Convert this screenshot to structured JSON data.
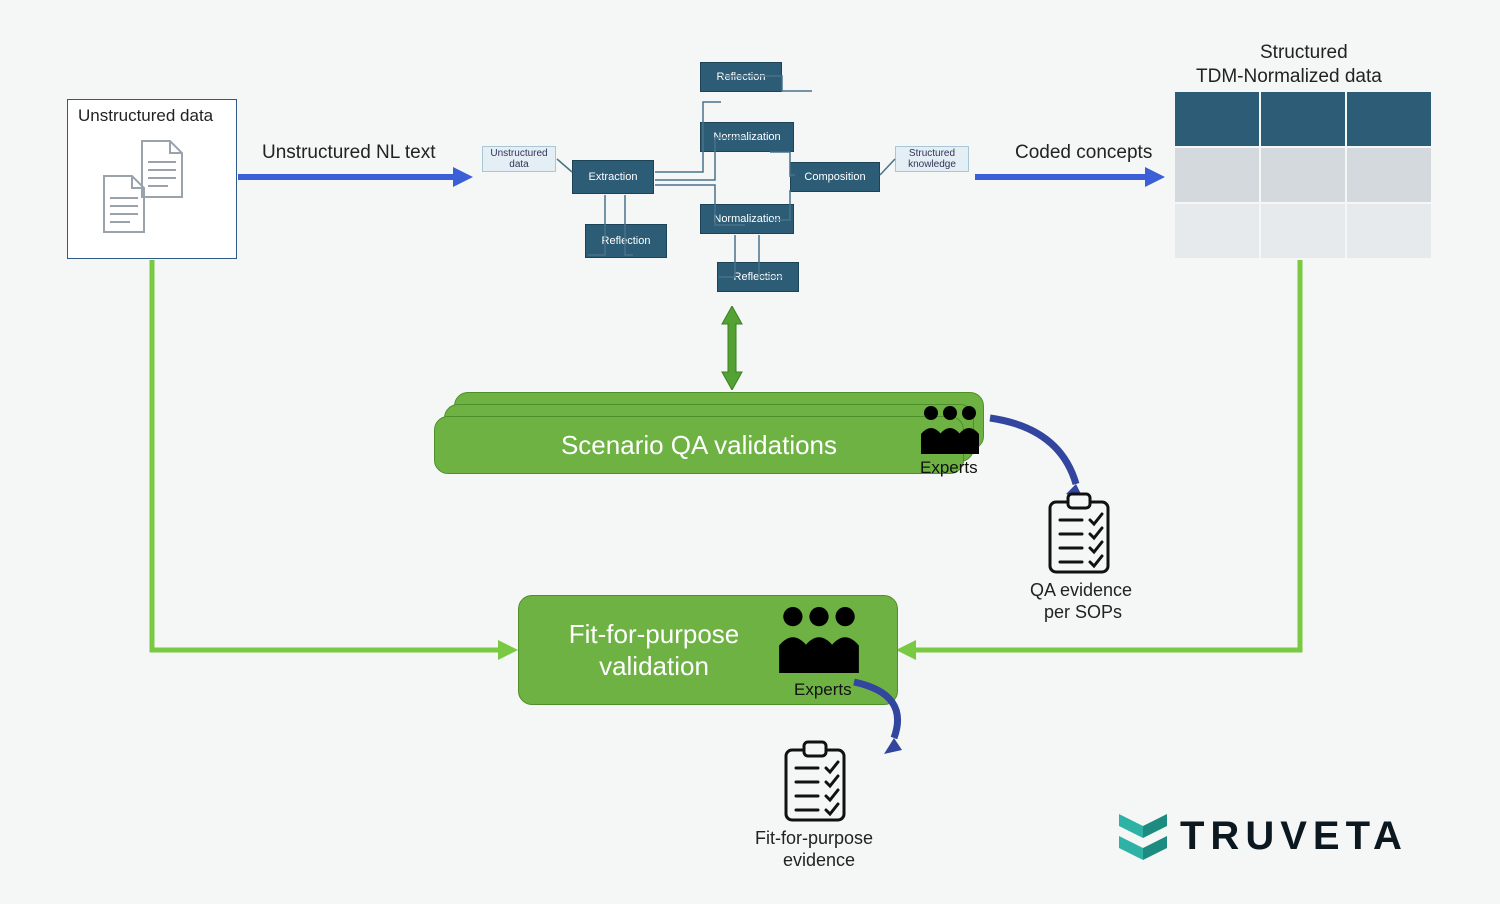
{
  "colors": {
    "blue_arrow": "#3a5fd6",
    "green_arrow": "#7ac943",
    "dark_teal": "#2d5d76",
    "bar_green": "#6eb243",
    "grid_light": "#dfe4e8",
    "brand_teal": "#2db2a5"
  },
  "source_box_title": "Unstructured data",
  "arrow1_label": "Unstructured NL text",
  "pipeline": {
    "input_tag": "Unstructured data",
    "output_tag": "Structured knowledge",
    "nodes": {
      "extraction": "Extraction",
      "composition": "Composition",
      "normalization1": "Normalization",
      "normalization2": "Normalization",
      "reflection_top": "Reflection",
      "reflection_mid": "Reflection",
      "reflection_bot": "Reflection"
    }
  },
  "arrow2_label": "Coded concepts",
  "grid_title1": "Structured",
  "grid_title2": "TDM-Normalized data",
  "scenario_bar": "Scenario QA validations",
  "scenario_experts": "Experts",
  "qa_evidence1": "QA evidence",
  "qa_evidence2": "per SOPs",
  "fit_box1": "Fit-for-purpose",
  "fit_box2": "validation",
  "fit_experts": "Experts",
  "fit_evidence1": "Fit-for-purpose",
  "fit_evidence2": "evidence",
  "brand": "TRUVETA"
}
